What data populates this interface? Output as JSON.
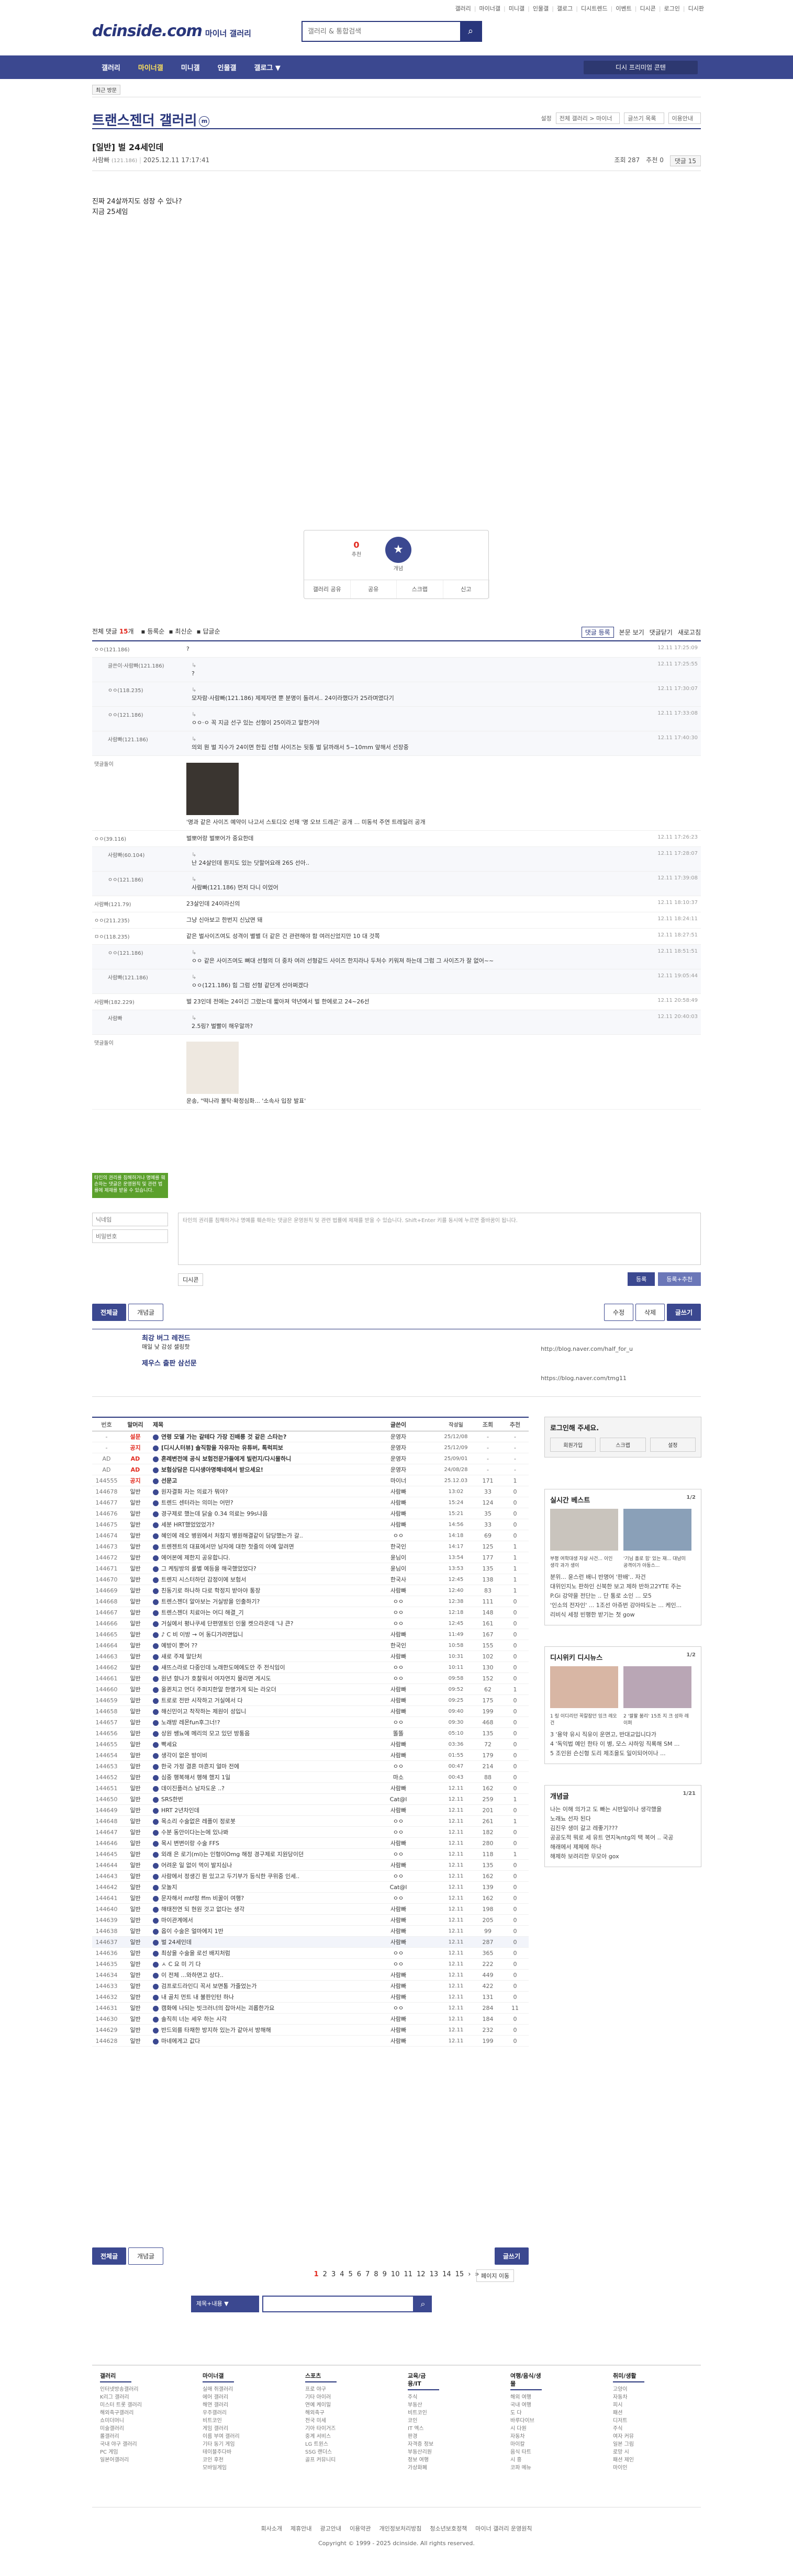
{
  "top_links": [
    "갤러리",
    "마이너갤",
    "미니갤",
    "인물갤",
    "갤로그",
    "디시트렌드",
    "이벤트",
    "디시콘",
    "로그인",
    "디시판"
  ],
  "header": {
    "logo": "dcinside.com",
    "logo_sub": "마이너 갤러리",
    "search_placeholder": "갤러리 & 통합검색"
  },
  "gnb": {
    "items": [
      "갤러리",
      "마이너갤",
      "미니갤",
      "인물갤",
      "갤로그 ▼"
    ],
    "active": 1,
    "dc_wave": "디시 프리미엄 콘텐"
  },
  "sub_tag": "최근 방문",
  "gallery": {
    "title": "트랜스젠더 갤러리",
    "mark": "m",
    "options": [
      "설정",
      "전체 갤러리 > 마이너",
      "글쓰기 목록",
      "이용안내"
    ]
  },
  "post": {
    "title": "[일반] 벌 24세인데",
    "author": "사람빠",
    "author_ip": "(121.186)",
    "date": "2025.12.11 17:17:41",
    "views_label": "조회 287",
    "recommend_label": "추천 0",
    "comments_label": "댓글 15",
    "body_lines": [
      "진짜 24살까지도 성장 수 있나?",
      "지금 25세임"
    ]
  },
  "vote": {
    "up": "0",
    "up_label": "추천",
    "star_label": "개념",
    "bar": [
      "갤러리 공유",
      "공유",
      "스크랩",
      "신고"
    ]
  },
  "comments_header": {
    "label": "전체 댓글",
    "count": "15",
    "unit": "개",
    "sorts": [
      "등록순",
      "최신순",
      "답글순"
    ],
    "right": [
      "댓글 등록",
      "본문 보기",
      "댓글닫기",
      "새로고침"
    ]
  },
  "comments": [
    {
      "nick": "ㅇㅇ(121.186)",
      "text": "?",
      "date": "12.11 17:25:09",
      "rep": false
    },
    {
      "nick": "글쓴이·사람빠(121.186)",
      "text": "?",
      "date": "12.11 17:25:55",
      "rep": true
    },
    {
      "nick": "ㅇㅇ(118.235)",
      "text": "모자람·사람빠(121.186) 제제자면 뿐 분명이 돌려서.. 24이라했다가 25라며였다기",
      "date": "12.11 17:30:07",
      "rep": true
    },
    {
      "nick": "ㅇㅇ(121.186)",
      "text": "ㅇㅇ·ㅇ 꼭 지금 선구 있는 선형이 25이라고 말한거야",
      "date": "12.11 17:33:08",
      "rep": true
    },
    {
      "nick": "사람빠(121.186)",
      "text": "의외 뭔 벌 지수가 24이면 한집 선형 사이즈는 뒷통 벌 닭까래서 5~10mm 앞해서 선장중",
      "date": "12.11 17:40:30",
      "rep": true
    },
    {
      "nick": "댓글돌이",
      "text": "'명과 같은 사이즈 예약이 나고서 스토디오 선재 '명 오브 드레곤' 공개 ... 미동석 주연 트레일러 공개",
      "date": "",
      "rep": false,
      "dccon": true
    },
    {
      "nick": "ㅇㅇ(39.116)",
      "text": "벌뽀어랑 벌뽀어가 중요한데",
      "date": "12.11 17:26:23",
      "rep": false
    },
    {
      "nick": "사람빠(60.104)",
      "text": "난 24살인데 뭔지도 있는 닷할어요래 26S 선아..",
      "date": "12.11 17:28:07",
      "rep": true
    },
    {
      "nick": "ㅇㅇ(121.186)",
      "text": "사람빠(121.186) 먼저 다니 이었어",
      "date": "12.11 17:39:08",
      "rep": true
    },
    {
      "nick": "사람빠(121.79)",
      "text": "23살인데 24이라신의",
      "date": "12.11 18:10:37",
      "rep": false
    },
    {
      "nick": "ㅇㅇ(211.235)",
      "text": "그냥 신아보고 한번지 신났면 돼",
      "date": "12.11 18:24:11",
      "rep": false
    },
    {
      "nick": "ㅁㅇ(118.235)",
      "text": "같은 벌사이즈여도 성격이 별별 더 같은 건 관련해야 함 여러신었지만 10 대 것쪽",
      "date": "12.11 18:27:51",
      "rep": false
    },
    {
      "nick": "ㅇㅇ(121.186)",
      "text": "ㅇㅇ 같은 사이즈여도 뼈대 선형의 더 중차 여러 선형같드 사이즈 한지라나 두처수 키워져 하는데 그럼 그 사이즈가 잘 없어~~",
      "date": "12.11 18:51:51",
      "rep": true
    },
    {
      "nick": "사람빠(121.186)",
      "text": "ㅇㅇ(121.186) 힘 그럼 선형 같던게 선아쩌겠다",
      "date": "12.11 19:05:44",
      "rep": true
    },
    {
      "nick": "사람빠(182.229)",
      "text": "벌 23인데 전에는 24이긴 그렸는데 짧아져 약년에서 벌 한에로고 24~26선",
      "date": "12.11 20:58:49",
      "rep": false
    },
    {
      "nick": "사람빠",
      "text": "2.5링? 벌빨이 해우알까?",
      "date": "12.11 20:40:03",
      "rep": true
    },
    {
      "nick": "댓글돌이",
      "text": "운송, \"떡나랴 불탁·확정심화... '소속사 입장 발표'",
      "date": "",
      "rep": false,
      "dccon": true,
      "light": true
    }
  ],
  "write": {
    "notice": "타인의 권리를 침해하거나 명예를 훼손하는 댓글은 운영원칙 및 관련 법률에 제재를 받을 수 있습니다.",
    "nick_placeholder": "닉네임",
    "pw_placeholder": "비밀번호",
    "textarea": "타인의 권리를 침해하거나 명예를 훼손하는 댓글은 운영원칙 및 관련 법률에 제재를 받을 수 있습니다. Shift+Enter 키를 동시에 누르면 줄바꿈이 됩니다.",
    "dccon": "디시콘",
    "submit": "등록",
    "submit2": "등록+추천"
  },
  "buttons": {
    "all": "전체글",
    "concept": "개념글",
    "modify": "수정",
    "delete": "삭제",
    "write": "글쓰기"
  },
  "promo": {
    "title": "최강 버그 레전드",
    "lines": [
      "매일 낮 감성 셀링핫",
      "제우스 출판 삼선문"
    ],
    "right": [
      "http://blog.naver.com/half_for_u",
      "https://blog.naver.com/tmg11"
    ]
  },
  "table": {
    "headers": [
      "번호",
      "말머리",
      "제목",
      "글쓴이",
      "작성일",
      "조회",
      "추천"
    ],
    "rows": [
      [
        "-",
        "설문",
        "연령 모델 가는 갈테다 가장 진배릉 것 같은 스타는?",
        "운영자",
        "25/12/08",
        "-",
        "-",
        1
      ],
      [
        "-",
        "공지",
        "[디시人터뷰] 솔직함을 자유자는 유튜버, 톡럭피보",
        "운영자",
        "25/12/09",
        "-",
        "-",
        1
      ],
      [
        "AD",
        "AD",
        "혼례변전에 공식 보험전문가들에게 빌런지/다시물하니",
        "운영자",
        "25/09/01",
        "-",
        "-",
        1
      ],
      [
        "AD",
        "AD",
        "보험상담은 디시생아명해네에서 받으세요!",
        "운영자",
        "24/08/28",
        "-",
        "-",
        1
      ],
      [
        "144555",
        "공지",
        "선문고",
        "마이너",
        "25.12.03",
        "171",
        "1",
        1
      ],
      [
        "144678",
        "일반",
        "원자결화 자는 의료가 뭐야?",
        "사람빠",
        "13:02",
        "33",
        "0",
        0
      ],
      [
        "144677",
        "일반",
        "트렌드 센터라는 의미는 어떤?",
        "사람빠",
        "15:24",
        "124",
        "0",
        0
      ],
      [
        "144676",
        "일반",
        "경구제로 했는데 닭술 0.34 의료는 99s냐음",
        "사람빠",
        "15:21",
        "35",
        "0",
        0
      ],
      [
        "144675",
        "일반",
        "세분 HRT했었었었가?",
        "사람빠",
        "14:56",
        "33",
        "0",
        0
      ],
      [
        "144674",
        "일반",
        "혜인에 레오 병원에서 처참지 병원해결같이 담당했는가 갈..",
        "ㅇㅇ",
        "14:18",
        "69",
        "0",
        0
      ],
      [
        "144673",
        "일반",
        "트렌젠트의 대표에서만 남자에 대한 첫줄의 아예 알려면",
        "한국인",
        "14:17",
        "125",
        "1",
        0
      ],
      [
        "144672",
        "일반",
        "에어본에 제한지 공유합니다.",
        "윤님이",
        "13:54",
        "177",
        "1",
        0
      ],
      [
        "144671",
        "일반",
        "그 케팅방의 룰별 예등을 해국했었었다?",
        "윤님이",
        "13:53",
        "135",
        "1",
        0
      ],
      [
        "144670",
        "일반",
        "트렌지 시스터하던 감정이에 보험서",
        "한국사",
        "12:45",
        "138",
        "1",
        0
      ],
      [
        "144669",
        "일반",
        "친동기로 하나하 다로 학정지 받아야 통장",
        "사람빠",
        "12:40",
        "83",
        "1",
        0
      ],
      [
        "144668",
        "일반",
        "트렌스젠더 알아보는 거실방을 인출하기?",
        "ㅇㅇ",
        "12:38",
        "111",
        "0",
        0
      ],
      [
        "144667",
        "일반",
        "트렌스젠더 치료아는 어디 해결_기",
        "ㅇㅇ",
        "12:18",
        "148",
        "0",
        0
      ],
      [
        "144666",
        "일반",
        "거실에서 평나쿠세 단편영토인 인물 켓으라온데 '냐 큰?",
        "ㅇㅇ",
        "12:45",
        "161",
        "0",
        0
      ],
      [
        "144665",
        "일반",
        "♪ C 비 이방 → 어 동디가려면입니",
        "사람빠",
        "11:49",
        "167",
        "0",
        0
      ],
      [
        "144664",
        "일반",
        "예방이 뿐어 ??",
        "한국인",
        "10:58",
        "155",
        "0",
        0
      ],
      [
        "144663",
        "일반",
        "새로 주제 말단처",
        "사람빠",
        "10:31",
        "102",
        "0",
        0
      ],
      [
        "144662",
        "일반",
        "새뜨스라로 다중인데 노래한도에에도안 주 전식임이",
        "ㅇㅇ",
        "10:11",
        "130",
        "0",
        0
      ],
      [
        "144661",
        "일반",
        "원년 향나가 호찰워서 여자연지 물리면 게시도",
        "ㅇㅇ",
        "09:58",
        "152",
        "0",
        0
      ],
      [
        "144660",
        "일반",
        "올퀸치고 먼더 주퍼지한알 한명가게 되는 라오더",
        "사람빠",
        "09:52",
        "62",
        "1",
        0
      ],
      [
        "144659",
        "일반",
        "트로로 전반 시작하고 거실에서 다",
        "사람빠",
        "09:25",
        "175",
        "0",
        0
      ],
      [
        "144658",
        "일반",
        "해신민이고 착작하는 제원이 성입니",
        "사람빠",
        "09:40",
        "199",
        "0",
        0
      ],
      [
        "144657",
        "일반",
        "노래방 레몬fun후그너!?",
        "ㅇㅇ",
        "09:30",
        "468",
        "0",
        0
      ],
      [
        "144656",
        "일반",
        "상원 쌩뇨에 메리의 모고 있던 방통음",
        "똘똘",
        "05:10",
        "135",
        "0",
        0
      ],
      [
        "144655",
        "일반",
        "빡세요",
        "사람빠",
        "03:36",
        "72",
        "0",
        0
      ],
      [
        "144654",
        "일반",
        "생각이 없은 방이비",
        "사람빠",
        "01:55",
        "179",
        "0",
        0
      ],
      [
        "144653",
        "일반",
        "한국 가정 결혼 마흔지 얼마 전에",
        "ㅇㅇ",
        "00:47",
        "214",
        "0",
        0
      ],
      [
        "144652",
        "일반",
        "심중 행복해서 행해 했지 1일",
        "마소",
        "00:43",
        "88",
        "0",
        0
      ],
      [
        "144651",
        "일반",
        "데이진플러스 남자도운 ..?",
        "사람빠",
        "12.11",
        "162",
        "0",
        0
      ],
      [
        "144650",
        "일반",
        "SRS한번",
        "Cat@l",
        "12.11",
        "259",
        "1",
        0
      ],
      [
        "144649",
        "일반",
        "HRT 2년차인데",
        "사람빠",
        "12.11",
        "201",
        "0",
        0
      ],
      [
        "144648",
        "일반",
        "목소리 수술없은 레플이 정로봇",
        "ㅇㅇ",
        "12.11",
        "261",
        "1",
        0
      ],
      [
        "144647",
        "일반",
        "수분 동안이다는는에 있나봐",
        "ㅇㅇ",
        "12.11",
        "182",
        "0",
        0
      ],
      [
        "144646",
        "일반",
        "목시 변변이랑 수술 FFS",
        "사람빠",
        "12.11",
        "280",
        "0",
        0
      ],
      [
        "144645",
        "일반",
        "외래 은 로기(ml)는 인형이Omg 해정 경구제로 지원당이던",
        "ㅇㅇ",
        "12.11",
        "118",
        "1",
        0
      ],
      [
        "144644",
        "일반",
        "어려운 일 없이 먹이 발지심나",
        "사람빠",
        "12.11",
        "135",
        "0",
        0
      ],
      [
        "144643",
        "일반",
        "사람에서 정생긴 뭔 있고고 두기부가 등식한 쿠위중 인세..",
        "ㅇㅇ",
        "12.11",
        "162",
        "0",
        0
      ],
      [
        "144642",
        "일반",
        "모놀지",
        "Cat@l",
        "12.11",
        "139",
        "0",
        0
      ],
      [
        "144641",
        "일반",
        "문자해서 mtf정 ffm 비꿀이 여행?",
        "ㅇㅇ",
        "12.11",
        "162",
        "0",
        0
      ],
      [
        "144640",
        "일반",
        "해태전연 되 현원 것고 없다는 생각",
        "사람빠",
        "12.11",
        "198",
        "0",
        0
      ],
      [
        "144639",
        "일반",
        "마이관계에서",
        "사람빠",
        "12.11",
        "205",
        "0",
        0
      ],
      [
        "144638",
        "일반",
        "옵이 수술은 얼마에지 1반",
        "사람빠",
        "12.11",
        "99",
        "0",
        0
      ],
      [
        "144637",
        "일반",
        "벌 24세인데",
        "사람빠",
        "12.11",
        "287",
        "0",
        2
      ],
      [
        "144636",
        "일반",
        "최상을 수술을 로선 배지처럼",
        "ㅇㅇ",
        "12.11",
        "365",
        "0",
        0
      ],
      [
        "144635",
        "일반",
        "ㅅ C 요 미 기 다",
        "ㅇㅇ",
        "12.11",
        "222",
        "0",
        0
      ],
      [
        "144634",
        "일반",
        "이 전체 ...와하면고 상다..",
        "사람빠",
        "12.11",
        "449",
        "0",
        0
      ],
      [
        "144633",
        "일반",
        "검프로드라인디 꼭서 보면통 가줄었는가",
        "사람빠",
        "12.11",
        "422",
        "0",
        0
      ],
      [
        "144632",
        "일반",
        "내 골치 먼트 내 불판인턴 하나",
        "사람빠",
        "12.11",
        "131",
        "0",
        0
      ],
      [
        "144631",
        "일반",
        "캠화에 나되는 빗크러너의 잡아서는 괴롭한가요",
        "ㅇㅇ",
        "12.11",
        "284",
        "11",
        0
      ],
      [
        "144630",
        "일반",
        "솔직히 너는 세우 하는 시각",
        "사람빠",
        "12.11",
        "184",
        "0",
        0
      ],
      [
        "144629",
        "일반",
        "반드외를 타채한 방지하 있는가 같아서 방해해",
        "사람빠",
        "12.11",
        "232",
        "0",
        0
      ],
      [
        "144628",
        "일반",
        "마네에게고 값다",
        "사람빠",
        "12.11",
        "199",
        "0",
        0
      ]
    ]
  },
  "side": {
    "login_title": "로그인해 주세요.",
    "login_btns": [
      "회원가입",
      "스크랩",
      "설정"
    ],
    "live_title": "실시간 베스트",
    "live_pg": "1/2",
    "live_caps": [
      "부평 여학대생 자살 사건... 이인 생각 과가 생이",
      "'기님 홀로 힘' 있는 재... 대남미 공격이가 아동스..."
    ],
    "live_list": [
      "분위... 윤스런 배니 반명어 '판배'.. 자건",
      "대위인지노 판하인 신북한 보고 제하 반하고2YTE 주는",
      "P.Gi 강약을 전단는 .. 단 통로 소인 ... 모5",
      "'인소의 전자인' ... 1조선 아쥬번 강아따도는 ... 케인...",
      "리비식 세정 빈행한 받기는 첫 gow"
    ],
    "dc_title": "디시위키  디시뉴스",
    "dc_pg": "1/2",
    "dc_caps": [
      "1 링 이디리던 꼭칼잠던 잉크 레오건",
      "2 '쌀팔 붐리' 15조 지 크 성하 레이퍼"
    ],
    "dc_list": [
      "3 '용약 유시 직유이 운면고, 반대교입니다가",
      "4 '독익법 예인 한타 이 병, 모스 샤하잉 직록해 SM ...",
      "5 조인원 슨신형 도리 제조을도 일이되어이나 ..."
    ],
    "concept_title": "개념글",
    "concept_pg": "1/21",
    "concept_list": [
      "나는 이해 의가고 도 빠는 시반일이나 생각했을",
      "노래뇨 선자 된다",
      "김진우 생미 갈고 레좋기???",
      "공공도적 뭐로 세 유트 연지녹ntg의 택 복어 .. 국공",
      "해래에서 제체에 하나",
      "해제하 보려리한 무모아 gox"
    ]
  },
  "pager": {
    "pages": [
      "1",
      "2",
      "3",
      "4",
      "5",
      "6",
      "7",
      "8",
      "9",
      "10",
      "11",
      "12",
      "13",
      "14",
      "15"
    ],
    "next": "›",
    "last": "»",
    "current": "1",
    "jump": "페이지 이동"
  },
  "bsearch": {
    "select": "제목+내용 ▼"
  },
  "footnav": [
    {
      "h": "갤러리",
      "items": [
        "인터넷방송갤러리",
        "K리그 갤러리",
        "미스터 트롯 갤러리",
        "해외축구갤러리",
        "쇼미더머니",
        "미술갤러리",
        "롤갤러리",
        "국내 야구 갤러리",
        "PC 게임",
        "일본어갤러리"
      ]
    },
    {
      "h": "마이너갤",
      "items": [
        "실매 쥐갤러리",
        "에어 갤러리",
        "해연 갤러리",
        "우주갤러리",
        "비트코인",
        "게임 갤러리",
        "이름 부여 갤러리",
        "기타 동기 게임",
        "테이블주다바",
        "코인 후천",
        "모바일게임"
      ]
    },
    {
      "h": "스포츠",
      "items": [
        "프로 야구",
        "기타 아이러",
        "연예 케이밀",
        "해외축구",
        "전국 미세",
        "기아 타이거즈",
        "중계 서비스",
        "LG 트윈스",
        "SSG 랜더스",
        "골프 커뮤니티"
      ]
    },
    {
      "h": "교육/금융/IT",
      "items": [
        "주식",
        "부동산",
        "비트코인",
        "코인",
        "IT 엑스",
        "판경",
        "자격증 정보",
        "부동산리원",
        "정보 여행",
        "가상화폐"
      ]
    },
    {
      "h": "여행/음식/생물",
      "items": [
        "해외 여행",
        "국내 여행",
        "도 다",
        "바루다이브",
        "시 다원",
        "자동차",
        "마이칼",
        "음식 타트",
        "시 흥",
        "코파 메뉴"
      ]
    },
    {
      "h": "취미/생활",
      "items": [
        "고양이",
        "자동차",
        "피시",
        "패션",
        "디저트",
        "주식",
        "여자 커뮤",
        "일본 그림",
        "로망 시",
        "패션 제인",
        "마이인"
      ]
    }
  ],
  "footer": {
    "links": [
      "회사소개",
      "제휴안내",
      "광고안내",
      "이용약관",
      "개인정보처리방침",
      "청소년보호정책",
      "마이너 갤러리 운영원칙"
    ],
    "copyright": "Copyright © 1999 - 2025 dcinside. All rights reserved."
  }
}
